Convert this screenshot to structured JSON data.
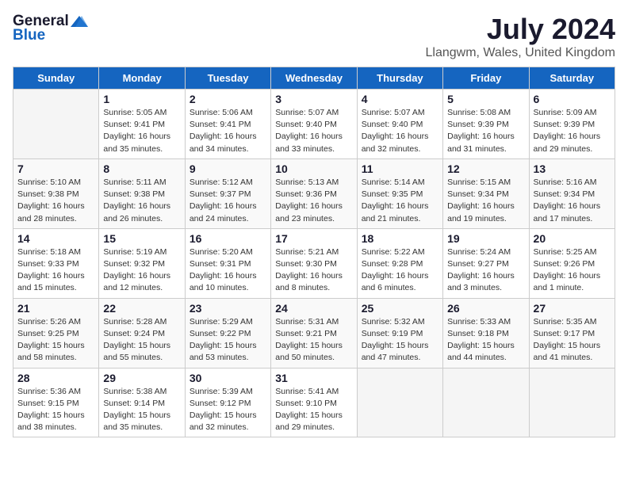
{
  "logo": {
    "general": "General",
    "blue": "Blue"
  },
  "title": {
    "month_year": "July 2024",
    "location": "Llangwm, Wales, United Kingdom"
  },
  "days_of_week": [
    "Sunday",
    "Monday",
    "Tuesday",
    "Wednesday",
    "Thursday",
    "Friday",
    "Saturday"
  ],
  "weeks": [
    [
      {
        "day": "",
        "info": ""
      },
      {
        "day": "1",
        "info": "Sunrise: 5:05 AM\nSunset: 9:41 PM\nDaylight: 16 hours\nand 35 minutes."
      },
      {
        "day": "2",
        "info": "Sunrise: 5:06 AM\nSunset: 9:41 PM\nDaylight: 16 hours\nand 34 minutes."
      },
      {
        "day": "3",
        "info": "Sunrise: 5:07 AM\nSunset: 9:40 PM\nDaylight: 16 hours\nand 33 minutes."
      },
      {
        "day": "4",
        "info": "Sunrise: 5:07 AM\nSunset: 9:40 PM\nDaylight: 16 hours\nand 32 minutes."
      },
      {
        "day": "5",
        "info": "Sunrise: 5:08 AM\nSunset: 9:39 PM\nDaylight: 16 hours\nand 31 minutes."
      },
      {
        "day": "6",
        "info": "Sunrise: 5:09 AM\nSunset: 9:39 PM\nDaylight: 16 hours\nand 29 minutes."
      }
    ],
    [
      {
        "day": "7",
        "info": "Sunrise: 5:10 AM\nSunset: 9:38 PM\nDaylight: 16 hours\nand 28 minutes."
      },
      {
        "day": "8",
        "info": "Sunrise: 5:11 AM\nSunset: 9:38 PM\nDaylight: 16 hours\nand 26 minutes."
      },
      {
        "day": "9",
        "info": "Sunrise: 5:12 AM\nSunset: 9:37 PM\nDaylight: 16 hours\nand 24 minutes."
      },
      {
        "day": "10",
        "info": "Sunrise: 5:13 AM\nSunset: 9:36 PM\nDaylight: 16 hours\nand 23 minutes."
      },
      {
        "day": "11",
        "info": "Sunrise: 5:14 AM\nSunset: 9:35 PM\nDaylight: 16 hours\nand 21 minutes."
      },
      {
        "day": "12",
        "info": "Sunrise: 5:15 AM\nSunset: 9:34 PM\nDaylight: 16 hours\nand 19 minutes."
      },
      {
        "day": "13",
        "info": "Sunrise: 5:16 AM\nSunset: 9:34 PM\nDaylight: 16 hours\nand 17 minutes."
      }
    ],
    [
      {
        "day": "14",
        "info": "Sunrise: 5:18 AM\nSunset: 9:33 PM\nDaylight: 16 hours\nand 15 minutes."
      },
      {
        "day": "15",
        "info": "Sunrise: 5:19 AM\nSunset: 9:32 PM\nDaylight: 16 hours\nand 12 minutes."
      },
      {
        "day": "16",
        "info": "Sunrise: 5:20 AM\nSunset: 9:31 PM\nDaylight: 16 hours\nand 10 minutes."
      },
      {
        "day": "17",
        "info": "Sunrise: 5:21 AM\nSunset: 9:30 PM\nDaylight: 16 hours\nand 8 minutes."
      },
      {
        "day": "18",
        "info": "Sunrise: 5:22 AM\nSunset: 9:28 PM\nDaylight: 16 hours\nand 6 minutes."
      },
      {
        "day": "19",
        "info": "Sunrise: 5:24 AM\nSunset: 9:27 PM\nDaylight: 16 hours\nand 3 minutes."
      },
      {
        "day": "20",
        "info": "Sunrise: 5:25 AM\nSunset: 9:26 PM\nDaylight: 16 hours\nand 1 minute."
      }
    ],
    [
      {
        "day": "21",
        "info": "Sunrise: 5:26 AM\nSunset: 9:25 PM\nDaylight: 15 hours\nand 58 minutes."
      },
      {
        "day": "22",
        "info": "Sunrise: 5:28 AM\nSunset: 9:24 PM\nDaylight: 15 hours\nand 55 minutes."
      },
      {
        "day": "23",
        "info": "Sunrise: 5:29 AM\nSunset: 9:22 PM\nDaylight: 15 hours\nand 53 minutes."
      },
      {
        "day": "24",
        "info": "Sunrise: 5:31 AM\nSunset: 9:21 PM\nDaylight: 15 hours\nand 50 minutes."
      },
      {
        "day": "25",
        "info": "Sunrise: 5:32 AM\nSunset: 9:19 PM\nDaylight: 15 hours\nand 47 minutes."
      },
      {
        "day": "26",
        "info": "Sunrise: 5:33 AM\nSunset: 9:18 PM\nDaylight: 15 hours\nand 44 minutes."
      },
      {
        "day": "27",
        "info": "Sunrise: 5:35 AM\nSunset: 9:17 PM\nDaylight: 15 hours\nand 41 minutes."
      }
    ],
    [
      {
        "day": "28",
        "info": "Sunrise: 5:36 AM\nSunset: 9:15 PM\nDaylight: 15 hours\nand 38 minutes."
      },
      {
        "day": "29",
        "info": "Sunrise: 5:38 AM\nSunset: 9:14 PM\nDaylight: 15 hours\nand 35 minutes."
      },
      {
        "day": "30",
        "info": "Sunrise: 5:39 AM\nSunset: 9:12 PM\nDaylight: 15 hours\nand 32 minutes."
      },
      {
        "day": "31",
        "info": "Sunrise: 5:41 AM\nSunset: 9:10 PM\nDaylight: 15 hours\nand 29 minutes."
      },
      {
        "day": "",
        "info": ""
      },
      {
        "day": "",
        "info": ""
      },
      {
        "day": "",
        "info": ""
      }
    ]
  ]
}
